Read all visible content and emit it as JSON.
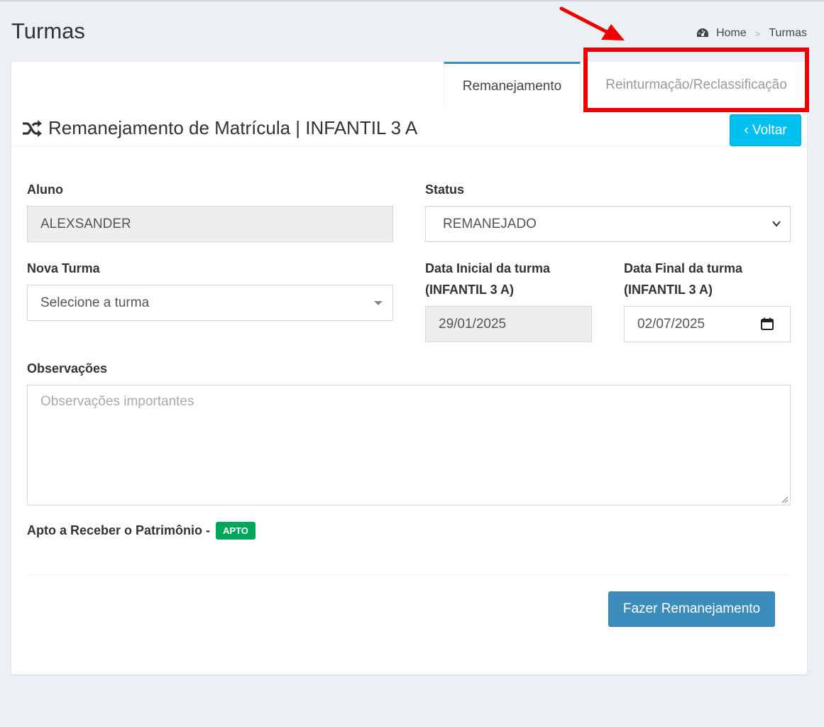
{
  "page": {
    "title": "Turmas"
  },
  "breadcrumb": {
    "home": "Home",
    "separator": ">",
    "current": "Turmas",
    "icon": "dashboard-icon"
  },
  "tabs": [
    {
      "label": "Remanejamento",
      "active": true
    },
    {
      "label": "Reinturmação/Reclassificação",
      "active": false
    }
  ],
  "header": {
    "title": "Remanejamento de Matrícula | INFANTIL 3 A",
    "icon": "shuffle-icon",
    "back_button": "‹ Voltar"
  },
  "form": {
    "aluno": {
      "label": "Aluno",
      "value": "ALEXSANDER"
    },
    "status": {
      "label": "Status",
      "value": "REMANEJADO"
    },
    "nova_turma": {
      "label": "Nova Turma",
      "placeholder": "Selecione a turma"
    },
    "data_inicial": {
      "label_line1": "Data Inicial da turma",
      "label_line2": "(INFANTIL 3 A)",
      "value": "29/01/2025"
    },
    "data_final": {
      "label_line1": "Data Final da turma",
      "label_line2": "(INFANTIL 3 A)",
      "value": "02/07/2025"
    },
    "observacoes": {
      "label": "Observações",
      "placeholder": "Observações importantes"
    },
    "apto": {
      "label": "Apto a Receber o Patrimônio -",
      "badge": "APTO"
    },
    "submit": "Fazer Remanejamento"
  },
  "colors": {
    "accent": "#3c8dbc",
    "info": "#00c0ef",
    "success": "#00a65a",
    "annotation": "#ee0000"
  }
}
